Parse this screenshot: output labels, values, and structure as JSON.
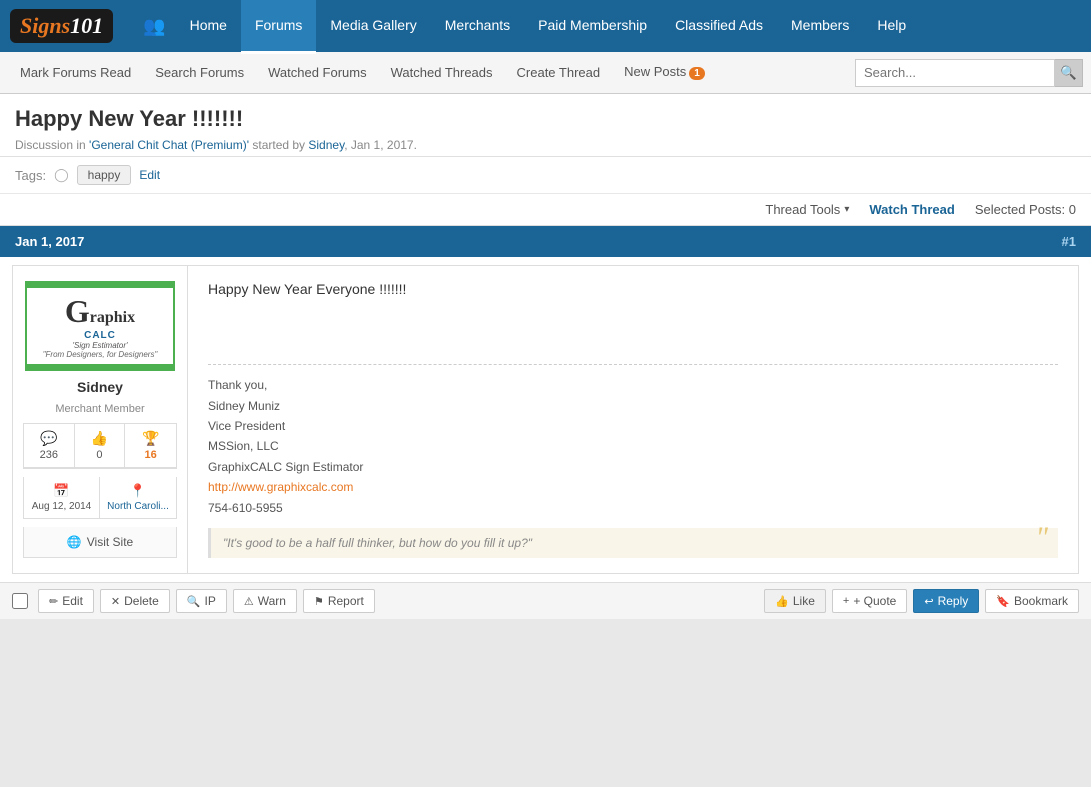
{
  "site": {
    "logo": "Signs101",
    "logo_number": "101"
  },
  "top_nav": {
    "icon_label": "⊞",
    "links": [
      {
        "id": "home",
        "label": "Home",
        "active": false
      },
      {
        "id": "forums",
        "label": "Forums",
        "active": true
      },
      {
        "id": "media-gallery",
        "label": "Media Gallery",
        "active": false
      },
      {
        "id": "merchants",
        "label": "Merchants",
        "active": false
      },
      {
        "id": "paid-membership",
        "label": "Paid Membership",
        "active": false
      },
      {
        "id": "classified-ads",
        "label": "Classified Ads",
        "active": false
      },
      {
        "id": "members",
        "label": "Members",
        "active": false
      },
      {
        "id": "help",
        "label": "Help",
        "active": false
      }
    ]
  },
  "sub_nav": {
    "links": [
      {
        "id": "mark-forums-read",
        "label": "Mark Forums Read"
      },
      {
        "id": "search-forums",
        "label": "Search Forums"
      },
      {
        "id": "watched-forums",
        "label": "Watched Forums"
      },
      {
        "id": "watched-threads",
        "label": "Watched Threads"
      },
      {
        "id": "create-thread",
        "label": "Create Thread"
      },
      {
        "id": "new-posts",
        "label": "New Posts"
      }
    ],
    "new_posts_badge": "1",
    "search_placeholder": "Search..."
  },
  "thread": {
    "title": "Happy New Year !!!!!!!",
    "meta_text": "Discussion in",
    "forum_name": "'General Chit Chat (Premium)'",
    "started_by": "started by",
    "author": "Sidney",
    "date": "Jan 1, 2017",
    "meta_dot": "."
  },
  "tags": {
    "label": "Tags:",
    "icon": "◯",
    "value": "happy",
    "edit_label": "Edit"
  },
  "thread_tools": {
    "tools_label": "Thread Tools",
    "watch_label": "Watch Thread",
    "selected_label": "Selected Posts: 0"
  },
  "post": {
    "date_header": "Jan 1, 2017",
    "post_number": "#1",
    "content": "Happy New Year Everyone !!!!!!!",
    "signature": {
      "line1": "Thank you,",
      "line2": "Sidney Muniz",
      "line3": "Vice President",
      "line4": "MSSion, LLC",
      "line5": "GraphixCALC Sign Estimator",
      "link_text": "http://www.graphixcalc.com",
      "phone": "754-610-5955"
    },
    "quote": "\"It's good to be a half full thinker, but how do you fill it up?\""
  },
  "user": {
    "name": "Sidney",
    "role": "Merchant Member",
    "stats": {
      "posts": "236",
      "likes": "0",
      "trophies": "16"
    },
    "join_date": "Aug 12, 2014",
    "location": "North Caroli...",
    "visit_site_label": "Visit Site"
  },
  "post_actions": {
    "edit_label": "Edit",
    "delete_label": "Delete",
    "ip_label": "IP",
    "warn_label": "Warn",
    "report_label": "Report",
    "like_label": "Like",
    "quote_label": "+ Quote",
    "reply_label": "Reply",
    "bookmark_label": "Bookmark"
  }
}
